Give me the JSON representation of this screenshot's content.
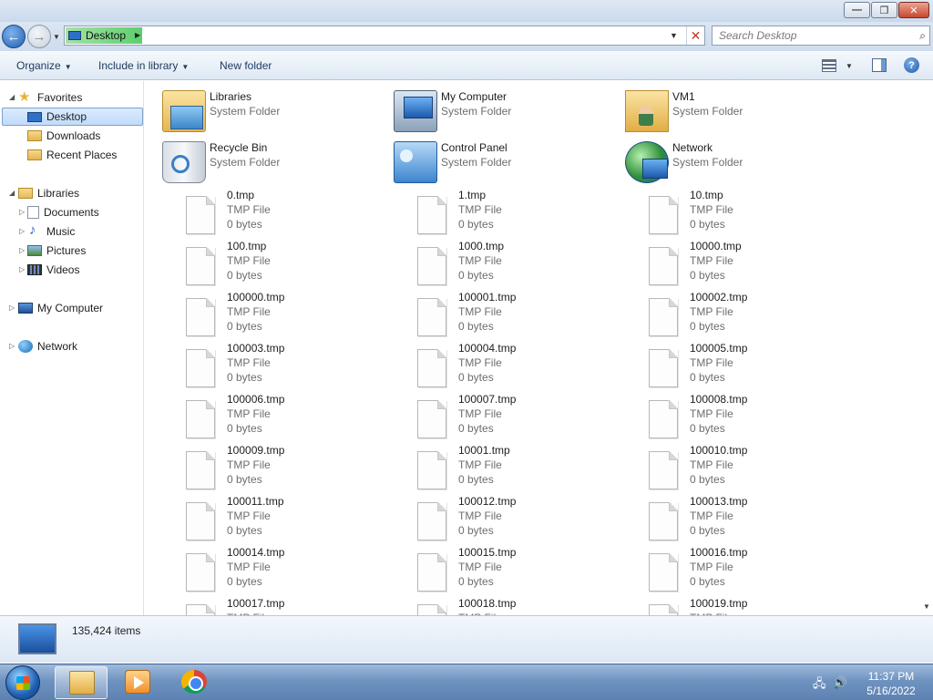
{
  "window": {
    "minimize_glyph": "—",
    "maximize_glyph": "❐",
    "close_glyph": "✕"
  },
  "address": {
    "location": "Desktop",
    "search_placeholder": "Search Desktop"
  },
  "toolbar": {
    "organize": "Organize",
    "include_in_library": "Include in library",
    "new_folder": "New folder",
    "help_glyph": "?"
  },
  "nav": {
    "favorites": "Favorites",
    "desktop": "Desktop",
    "downloads": "Downloads",
    "recent_places": "Recent Places",
    "libraries": "Libraries",
    "documents": "Documents",
    "music": "Music",
    "pictures": "Pictures",
    "videos": "Videos",
    "my_computer": "My Computer",
    "network": "Network"
  },
  "system_items": [
    {
      "name": "Libraries",
      "type": "System Folder",
      "icon": "libraries-icon"
    },
    {
      "name": "My Computer",
      "type": "System Folder",
      "icon": "my-computer-icon"
    },
    {
      "name": "VM1",
      "type": "System Folder",
      "icon": "user-folder-icon"
    },
    {
      "name": "Recycle Bin",
      "type": "System Folder",
      "icon": "recycle-bin-icon"
    },
    {
      "name": "Control Panel",
      "type": "System Folder",
      "icon": "control-panel-icon"
    },
    {
      "name": "Network",
      "type": "System Folder",
      "icon": "network-icon"
    }
  ],
  "files": [
    {
      "name": "0.tmp",
      "type": "TMP File",
      "size": "0 bytes"
    },
    {
      "name": "1.tmp",
      "type": "TMP File",
      "size": "0 bytes"
    },
    {
      "name": "10.tmp",
      "type": "TMP File",
      "size": "0 bytes"
    },
    {
      "name": "100.tmp",
      "type": "TMP File",
      "size": "0 bytes"
    },
    {
      "name": "1000.tmp",
      "type": "TMP File",
      "size": "0 bytes"
    },
    {
      "name": "10000.tmp",
      "type": "TMP File",
      "size": "0 bytes"
    },
    {
      "name": "100000.tmp",
      "type": "TMP File",
      "size": "0 bytes"
    },
    {
      "name": "100001.tmp",
      "type": "TMP File",
      "size": "0 bytes"
    },
    {
      "name": "100002.tmp",
      "type": "TMP File",
      "size": "0 bytes"
    },
    {
      "name": "100003.tmp",
      "type": "TMP File",
      "size": "0 bytes"
    },
    {
      "name": "100004.tmp",
      "type": "TMP File",
      "size": "0 bytes"
    },
    {
      "name": "100005.tmp",
      "type": "TMP File",
      "size": "0 bytes"
    },
    {
      "name": "100006.tmp",
      "type": "TMP File",
      "size": "0 bytes"
    },
    {
      "name": "100007.tmp",
      "type": "TMP File",
      "size": "0 bytes"
    },
    {
      "name": "100008.tmp",
      "type": "TMP File",
      "size": "0 bytes"
    },
    {
      "name": "100009.tmp",
      "type": "TMP File",
      "size": "0 bytes"
    },
    {
      "name": "10001.tmp",
      "type": "TMP File",
      "size": "0 bytes"
    },
    {
      "name": "100010.tmp",
      "type": "TMP File",
      "size": "0 bytes"
    },
    {
      "name": "100011.tmp",
      "type": "TMP File",
      "size": "0 bytes"
    },
    {
      "name": "100012.tmp",
      "type": "TMP File",
      "size": "0 bytes"
    },
    {
      "name": "100013.tmp",
      "type": "TMP File",
      "size": "0 bytes"
    },
    {
      "name": "100014.tmp",
      "type": "TMP File",
      "size": "0 bytes"
    },
    {
      "name": "100015.tmp",
      "type": "TMP File",
      "size": "0 bytes"
    },
    {
      "name": "100016.tmp",
      "type": "TMP File",
      "size": "0 bytes"
    },
    {
      "name": "100017.tmp",
      "type": "TMP File",
      "size": ""
    },
    {
      "name": "100018.tmp",
      "type": "TMP File",
      "size": ""
    },
    {
      "name": "100019.tmp",
      "type": "TMP File",
      "size": ""
    }
  ],
  "status": {
    "item_count": "135,424 items"
  },
  "clock": {
    "time": "11:37 PM",
    "date": "5/16/2022"
  }
}
